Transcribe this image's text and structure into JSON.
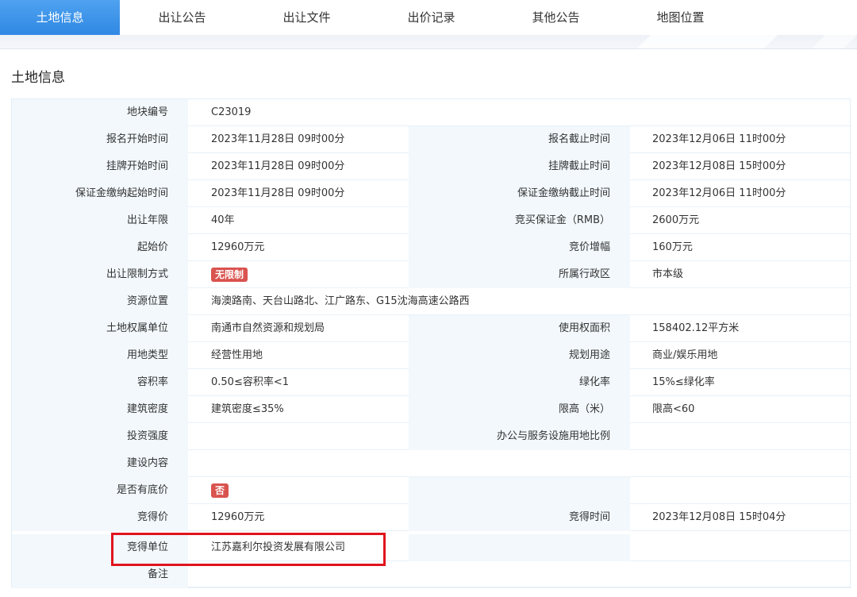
{
  "tabs": [
    {
      "label": "土地信息",
      "active": true
    },
    {
      "label": "出让公告",
      "active": false
    },
    {
      "label": "出让文件",
      "active": false
    },
    {
      "label": "出价记录",
      "active": false
    },
    {
      "label": "其他公告",
      "active": false
    },
    {
      "label": "地图位置",
      "active": false
    }
  ],
  "section_title": "土地信息",
  "rows": [
    {
      "l1": "地块编号",
      "v1": "C23019"
    },
    {
      "l1": "报名开始时间",
      "v1": "2023年11月28日 09时00分",
      "l2": "报名截止时间",
      "v2": "2023年12月06日 11时00分"
    },
    {
      "l1": "挂牌开始时间",
      "v1": "2023年11月28日 09时00分",
      "l2": "挂牌截止时间",
      "v2": "2023年12月08日 15时00分"
    },
    {
      "l1": "保证金缴纳起始时间",
      "v1": "2023年11月28日 09时00分",
      "l2": "保证金缴纳截止时间",
      "v2": "2023年12月06日 11时00分"
    },
    {
      "l1": "出让年限",
      "v1": "40年",
      "l2": "竞买保证金（RMB）",
      "v2": "2600万元"
    },
    {
      "l1": "起始价",
      "v1": "12960万元",
      "l2": "竞价增幅",
      "v2": "160万元"
    },
    {
      "l1": "出让限制方式",
      "badge1": "无限制",
      "l2": "所属行政区",
      "v2": "市本级"
    },
    {
      "l1": "资源位置",
      "v1": "海澳路南、天台山路北、江广路东、G15沈海高速公路西"
    },
    {
      "l1": "土地权属单位",
      "v1": "南通市自然资源和规划局",
      "l2": "使用权面积",
      "v2": "158402.12平方米"
    },
    {
      "l1": "用地类型",
      "v1": "经营性用地",
      "l2": "规划用途",
      "v2": "商业/娱乐用地"
    },
    {
      "l1": "容积率",
      "v1": "0.50≤容积率<1",
      "l2": "绿化率",
      "v2": "15%≤绿化率"
    },
    {
      "l1": "建筑密度",
      "v1": "建筑密度≤35%",
      "l2": "限高（米）",
      "v2": "限高<60"
    },
    {
      "l1": "投资强度",
      "v1": "",
      "l2": "办公与服务设施用地比例",
      "v2": ""
    },
    {
      "l1": "建设内容",
      "v1": ""
    },
    {
      "l1": "是否有底价",
      "badge1": "否",
      "l2": "",
      "v2": ""
    },
    {
      "l1": "竞得价",
      "v1": "12960万元",
      "l2": "竞得时间",
      "v2": "2023年12月08日 15时04分"
    },
    {
      "l1": "竞得单位",
      "v1": "江苏嘉利尔投资发展有限公司",
      "l2": "",
      "v2": ""
    },
    {
      "l1": "备注",
      "v1": ""
    }
  ],
  "colors": {
    "accent": "#2f88e3",
    "badge": "#d9534f",
    "highlight": "#e0141e"
  }
}
